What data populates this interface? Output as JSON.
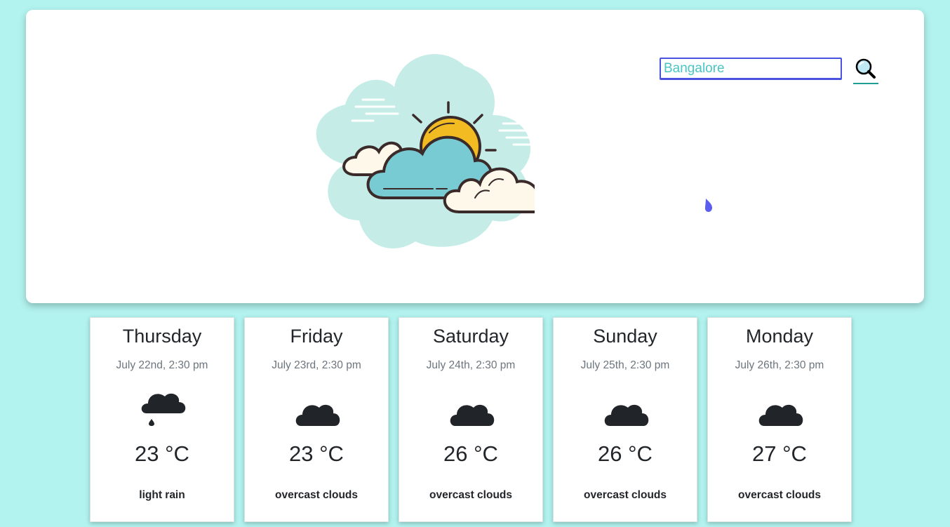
{
  "search": {
    "value": "Bangalore",
    "button_icon": "search-icon"
  },
  "hero": {
    "illustration": "partly-cloudy-illustration",
    "marker_icon": "water-drop-icon",
    "accent_color": "#4a52e0"
  },
  "forecast": [
    {
      "day": "Thursday",
      "date": "July 22nd, 2:30 pm",
      "icon": "rain-cloud-icon",
      "temp": "23 °C",
      "desc": "light rain"
    },
    {
      "day": "Friday",
      "date": "July 23rd, 2:30 pm",
      "icon": "cloud-icon",
      "temp": "23 °C",
      "desc": "overcast clouds"
    },
    {
      "day": "Saturday",
      "date": "July 24th, 2:30 pm",
      "icon": "cloud-icon",
      "temp": "26 °C",
      "desc": "overcast clouds"
    },
    {
      "day": "Sunday",
      "date": "July 25th, 2:30 pm",
      "icon": "cloud-icon",
      "temp": "26 °C",
      "desc": "overcast clouds"
    },
    {
      "day": "Monday",
      "date": "July 26th, 2:30 pm",
      "icon": "cloud-icon",
      "temp": "27 °C",
      "desc": "overcast clouds"
    }
  ],
  "colors": {
    "background": "#b2f3ef",
    "card": "#ffffff",
    "text": "#222529",
    "muted": "#6c757d"
  }
}
